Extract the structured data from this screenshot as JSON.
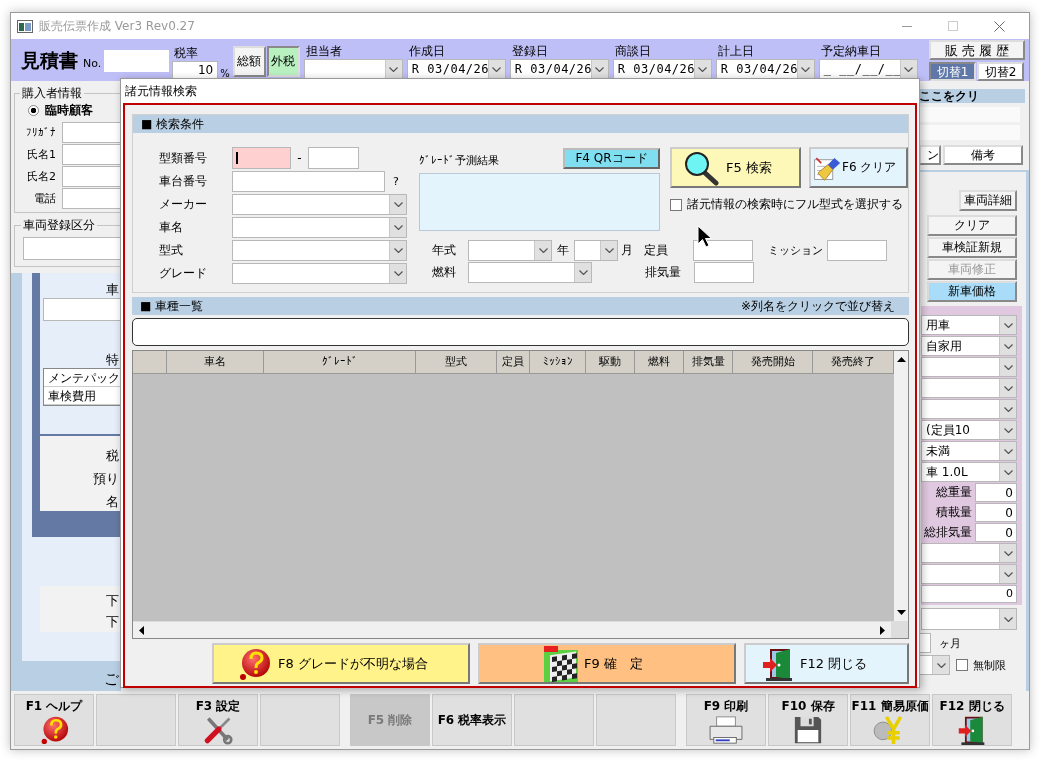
{
  "window": {
    "title": "販売伝票作成 Ver3 Rev0.27"
  },
  "header": {
    "doc_title": "見積書",
    "no_label": "No.",
    "tax_rate": {
      "label": "税率",
      "value": "10",
      "unit": "%"
    },
    "tax_modes": [
      {
        "label": "総額",
        "selected": false
      },
      {
        "label": "外税",
        "selected": true
      }
    ],
    "date_fields": [
      {
        "label": "担当者"
      },
      {
        "label": "作成日",
        "value": "R 03/04/26"
      },
      {
        "label": "登録日",
        "value": "R 03/04/26"
      },
      {
        "label": "商談日",
        "value": "R 03/04/26"
      },
      {
        "label": "計上日",
        "value": "R 03/04/26"
      },
      {
        "label": "予定納車日",
        "value": "_ __/__/__"
      }
    ],
    "history_button": "販 売 履 歴",
    "switch_tabs": [
      {
        "label": "切替1",
        "selected": true
      },
      {
        "label": "切替2",
        "selected": false
      }
    ]
  },
  "buyer": {
    "legend": "購入者情報",
    "customer_types": [
      {
        "label": "臨時顧客",
        "selected": true
      }
    ],
    "fields": [
      "ﾌﾘｶﾞﾅ",
      "氏名1",
      "氏名2",
      "電話"
    ]
  },
  "registration": {
    "legend": "車両登録区分"
  },
  "vehicle_section": {
    "label_1": "車",
    "label_2": "特",
    "options": [
      "メンテパック",
      "車検費用"
    ]
  },
  "tax_section": {
    "labels": [
      "税",
      "預り",
      "名"
    ]
  },
  "lower_section": {
    "labels": [
      "下",
      "下"
    ]
  },
  "footer_text": "ご",
  "right_panel": {
    "header": "ここをクリ",
    "tabs": [
      "ン",
      "備考"
    ],
    "buttons": [
      {
        "label": "車両詳細",
        "disabled": false,
        "active": false
      },
      {
        "label": "クリア",
        "disabled": false,
        "active": false
      },
      {
        "label": "車検証新規",
        "disabled": false,
        "active": false
      },
      {
        "label": "車両修正",
        "disabled": true,
        "active": false
      },
      {
        "label": "新車価格",
        "disabled": false,
        "active": true
      }
    ],
    "vehicle_selects": [
      {
        "kind": "select",
        "value": "用車"
      },
      {
        "kind": "select",
        "value": "自家用"
      },
      {
        "kind": "select"
      },
      {
        "kind": "select"
      },
      {
        "kind": "select"
      },
      {
        "kind": "select",
        "value": "(定員10"
      },
      {
        "kind": "select",
        "value": "未満"
      },
      {
        "kind": "select",
        "value": "車 1.0L"
      }
    ],
    "measures": [
      {
        "label": "総重量",
        "value": "0"
      },
      {
        "label": "積載量",
        "value": "0"
      },
      {
        "label": "総排気量",
        "value": "0"
      }
    ],
    "more_fields": [
      {
        "kind": "select"
      },
      {
        "kind": "select"
      },
      {
        "kind": "input",
        "value": "0"
      }
    ],
    "period_unit": "ヶ月",
    "unlimited": {
      "label": "無制限",
      "checked": false
    }
  },
  "dialog": {
    "title": "諸元情報検索",
    "criteria": {
      "header": "■ 検索条件",
      "model_code": {
        "label": "型類番号",
        "separator": "-"
      },
      "chassis": {
        "label": "車台番号",
        "hint": "?"
      },
      "selects": [
        {
          "label": "メーカー"
        },
        {
          "label": "車名"
        },
        {
          "label": "型式"
        },
        {
          "label": "グレード"
        }
      ],
      "grade_prediction": {
        "label": "ｸﾞﾚｰﾄﾞ予測結果"
      },
      "qr_button": "F4 QRコード",
      "search_button": "F5 検索",
      "clear_button": "F6 クリア",
      "full_model_option": {
        "label": "諸元情報の検索時にフル型式を選択する",
        "checked": false
      },
      "year": {
        "label": "年式",
        "year_unit": "年",
        "month_unit": "月"
      },
      "fuel": {
        "label": "燃料"
      },
      "capacity": {
        "label": "定員"
      },
      "transmission": {
        "label": "ミッション"
      },
      "displacement": {
        "label": "排気量"
      }
    },
    "list": {
      "header": "■ 車種一覧",
      "note": "※列名をクリックで並び替え",
      "columns": [
        "車名",
        "ｸﾞﾚｰﾄﾞ",
        "型式",
        "定員",
        "ﾐｯｼｮﾝ",
        "駆動",
        "燃料",
        "排気量",
        "発売開始",
        "発売終了"
      ]
    },
    "actions": [
      {
        "label": "F8 グレードが不明な場合",
        "kind": "unknown"
      },
      {
        "label": "F9 確　定",
        "kind": "confirm"
      },
      {
        "label": "F12 閉じる",
        "kind": "close"
      }
    ]
  },
  "function_keys": [
    {
      "kind": "help",
      "label": "F1 ヘルプ",
      "disabled": false
    },
    {
      "kind": "blank"
    },
    {
      "kind": "settings",
      "label": "F3 設定",
      "disabled": false
    },
    {
      "kind": "blank"
    },
    {
      "kind": "plain",
      "label": "F5 削除",
      "disabled": true
    },
    {
      "kind": "plain",
      "label": "F6 税率表示",
      "disabled": false
    },
    {
      "kind": "blank"
    },
    {
      "kind": "blank"
    },
    {
      "kind": "print",
      "label": "F9 印刷",
      "disabled": false
    },
    {
      "kind": "save",
      "label": "F10 保存",
      "disabled": false
    },
    {
      "kind": "cost",
      "label": "F11 簡易原価",
      "disabled": false
    },
    {
      "kind": "close",
      "label": "F12 閉じる",
      "disabled": false
    }
  ]
}
